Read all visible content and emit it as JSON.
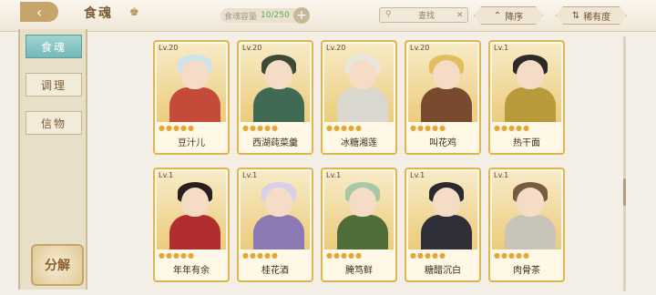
{
  "header": {
    "back_icon": "back-arrow-icon",
    "title": "食魂",
    "crown_icon": "crown-icon"
  },
  "capacity": {
    "label": "食魂容量",
    "count": "10/250",
    "add_icon": "plus-icon"
  },
  "search": {
    "icon": "search-icon",
    "placeholder": "查找",
    "clear_icon": "close-icon"
  },
  "sort": {
    "order_label": "降序",
    "rarity_label": "稀有度",
    "order_icon": "chevron-up-icon",
    "rarity_icon": "arrows-updown-icon"
  },
  "sidebar": {
    "tabs": [
      {
        "label": "食魂"
      },
      {
        "label": "调理"
      },
      {
        "label": "信物"
      }
    ],
    "decompose_label": "分解"
  },
  "cards": [
    {
      "level": "Lv.20",
      "name": "豆汁儿",
      "hair": "#cfe3ec",
      "body": "#c44a3a"
    },
    {
      "level": "Lv.20",
      "name": "西湖莼菜羹",
      "hair": "#3d4a36",
      "body": "#3f6b54"
    },
    {
      "level": "Lv.20",
      "name": "冰糖湘莲",
      "hair": "#e9e6df",
      "body": "#dad7cf"
    },
    {
      "level": "Lv.20",
      "name": "叫花鸡",
      "hair": "#e2be5e",
      "body": "#7a4a2e"
    },
    {
      "level": "Lv.1",
      "name": "热干面",
      "hair": "#2d2a2a",
      "body": "#b89a3a"
    },
    {
      "level": "Lv.1",
      "name": "年年有余",
      "hair": "#2a1f1f",
      "body": "#b22e2e"
    },
    {
      "level": "Lv.1",
      "name": "桂花酒",
      "hair": "#d8d0e8",
      "body": "#8b79b4"
    },
    {
      "level": "Lv.1",
      "name": "腌笃鲜",
      "hair": "#a7c8a8",
      "body": "#4f6e3a"
    },
    {
      "level": "Lv.1",
      "name": "糖醋沉白",
      "hair": "#2a2a2a",
      "body": "#2f2f3a"
    },
    {
      "level": "Lv.1",
      "name": "肉骨茶",
      "hair": "#7a5a40",
      "body": "#c9c4b8"
    }
  ]
}
